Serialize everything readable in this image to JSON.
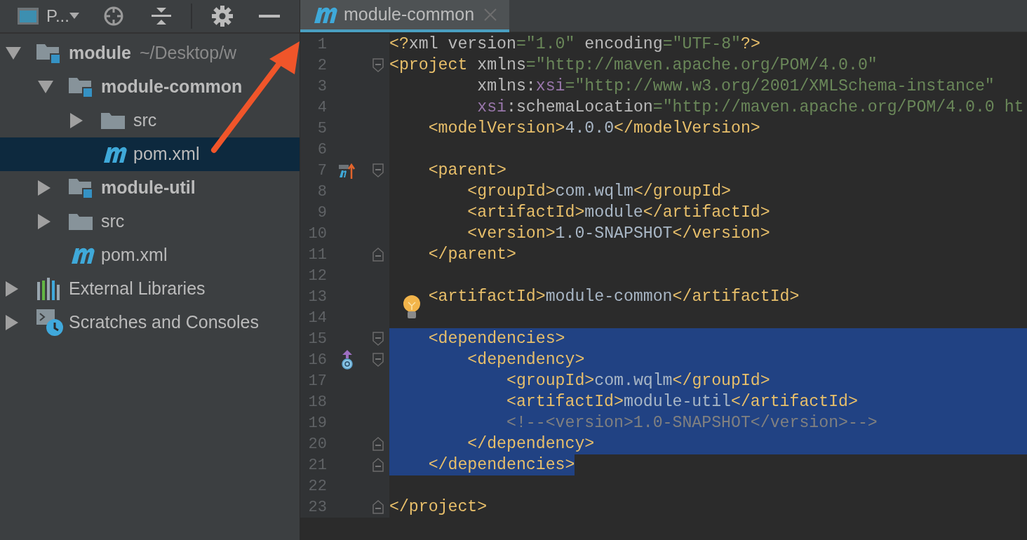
{
  "project_panel": {
    "view_label": "P...",
    "tree": [
      {
        "label": "module",
        "detail": "~/Desktop/w",
        "kind": "module",
        "bold": true,
        "expanded": true,
        "selected": false,
        "children": [
          {
            "label": "module-common",
            "kind": "module",
            "bold": true,
            "expanded": true,
            "selected": false,
            "children": [
              {
                "label": "src",
                "kind": "folder",
                "bold": false,
                "expanded": false,
                "selected": false
              },
              {
                "label": "pom.xml",
                "kind": "maven",
                "bold": false,
                "selected": true
              }
            ]
          },
          {
            "label": "module-util",
            "kind": "module",
            "bold": true,
            "expanded": false,
            "selected": false
          },
          {
            "label": "src",
            "kind": "folder",
            "bold": false,
            "expanded": false,
            "selected": false
          },
          {
            "label": "pom.xml",
            "kind": "maven",
            "bold": false,
            "selected": false
          }
        ]
      },
      {
        "label": "External Libraries",
        "kind": "libraries",
        "bold": false,
        "expanded": false,
        "selected": false
      },
      {
        "label": "Scratches and Consoles",
        "kind": "scratches",
        "bold": false,
        "expanded": false,
        "selected": false
      }
    ]
  },
  "editor": {
    "tabs": [
      {
        "label": "module-common",
        "selected": true
      }
    ],
    "lines": [
      {
        "number": "1",
        "selected": false,
        "tokens": [
          {
            "kind": "tag",
            "text": "<?"
          },
          {
            "kind": "attr",
            "text": "xml version"
          },
          {
            "kind": "value",
            "text": "=\"1.0\""
          },
          {
            "kind": "attr",
            "text": " encoding"
          },
          {
            "kind": "value",
            "text": "=\"UTF-8\""
          },
          {
            "kind": "tag",
            "text": "?>"
          }
        ]
      },
      {
        "number": "2",
        "selected": false,
        "fold_start": true,
        "tokens": [
          {
            "kind": "tag",
            "text": "<project"
          },
          {
            "kind": "attr",
            "text": " xmlns"
          },
          {
            "kind": "value",
            "text": "=\"http://maven.apache.org/POM/4.0.0\""
          }
        ]
      },
      {
        "number": "3",
        "selected": false,
        "tokens": [
          {
            "kind": "attr",
            "text": "         xmlns:"
          },
          {
            "kind": "ns",
            "text": "xsi"
          },
          {
            "kind": "value",
            "text": "=\"http://www.w3.org/2001/XMLSchema-instance\""
          }
        ]
      },
      {
        "number": "4",
        "selected": false,
        "tokens": [
          {
            "kind": "ns",
            "text": "         xsi"
          },
          {
            "kind": "attr",
            "text": ":schemaLocation"
          },
          {
            "kind": "value",
            "text": "=\"http://maven.apache.org/POM/4.0.0 ht"
          }
        ]
      },
      {
        "number": "5",
        "selected": false,
        "tokens": [
          {
            "kind": "tag",
            "text": "    <modelVersion>"
          },
          {
            "kind": "text",
            "text": "4.0.0"
          },
          {
            "kind": "tag",
            "text": "</modelVersion>"
          }
        ]
      },
      {
        "number": "6",
        "selected": false
      },
      {
        "number": "7",
        "selected": false,
        "fold_start": true,
        "parent_marker": true,
        "tokens": [
          {
            "kind": "tag",
            "text": "    <parent>"
          }
        ]
      },
      {
        "number": "8",
        "selected": false,
        "tokens": [
          {
            "kind": "tag",
            "text": "        <groupId>"
          },
          {
            "kind": "text",
            "text": "com.wqlm"
          },
          {
            "kind": "tag",
            "text": "</groupId>"
          }
        ]
      },
      {
        "number": "9",
        "selected": false,
        "tokens": [
          {
            "kind": "tag",
            "text": "        <artifactId>"
          },
          {
            "kind": "text",
            "text": "module"
          },
          {
            "kind": "tag",
            "text": "</artifactId>"
          }
        ]
      },
      {
        "number": "10",
        "selected": false,
        "tokens": [
          {
            "kind": "tag",
            "text": "        <version>"
          },
          {
            "kind": "text",
            "text": "1.0-SNAPSHOT"
          },
          {
            "kind": "tag",
            "text": "</version>"
          }
        ]
      },
      {
        "number": "11",
        "selected": false,
        "fold_end": true,
        "tokens": [
          {
            "kind": "tag",
            "text": "    </parent>"
          }
        ]
      },
      {
        "number": "12",
        "selected": false
      },
      {
        "number": "13",
        "selected": false,
        "tokens": [
          {
            "kind": "tag",
            "text": "    <artifactId>"
          },
          {
            "kind": "text",
            "text": "module-common"
          },
          {
            "kind": "tag",
            "text": "</artifactId>"
          }
        ]
      },
      {
        "number": "14",
        "selected": false,
        "bulb": true
      },
      {
        "number": "15",
        "selected": true,
        "fold_start": true,
        "tokens": [
          {
            "kind": "tag",
            "text": "    <dependencies>"
          }
        ]
      },
      {
        "number": "16",
        "selected": true,
        "fold_start": true,
        "dependency_marker": true,
        "tokens": [
          {
            "kind": "tag",
            "text": "        <dependency>"
          }
        ]
      },
      {
        "number": "17",
        "selected": true,
        "tokens": [
          {
            "kind": "tag",
            "text": "            <groupId>"
          },
          {
            "kind": "text",
            "text": "com.wqlm"
          },
          {
            "kind": "tag",
            "text": "</groupId>"
          }
        ]
      },
      {
        "number": "18",
        "selected": true,
        "tokens": [
          {
            "kind": "tag",
            "text": "            <artifactId>"
          },
          {
            "kind": "text",
            "text": "module-util"
          },
          {
            "kind": "tag",
            "text": "</artifactId>"
          }
        ]
      },
      {
        "number": "19",
        "selected": true,
        "tokens": [
          {
            "kind": "comment",
            "text": "            <!--<version>1.0-SNAPSHOT</version>-->"
          }
        ]
      },
      {
        "number": "20",
        "selected": true,
        "fold_end": true,
        "tokens": [
          {
            "kind": "tag",
            "text": "        </dependency>"
          }
        ]
      },
      {
        "number": "21",
        "selected": true,
        "fold_end": true,
        "tokens": [
          {
            "kind": "tag",
            "text": "    </dependencies>"
          }
        ]
      },
      {
        "number": "22",
        "selected": false
      },
      {
        "number": "23",
        "selected": false,
        "fold_end": true,
        "tokens": [
          {
            "kind": "tag",
            "text": "</project>"
          }
        ]
      }
    ]
  }
}
